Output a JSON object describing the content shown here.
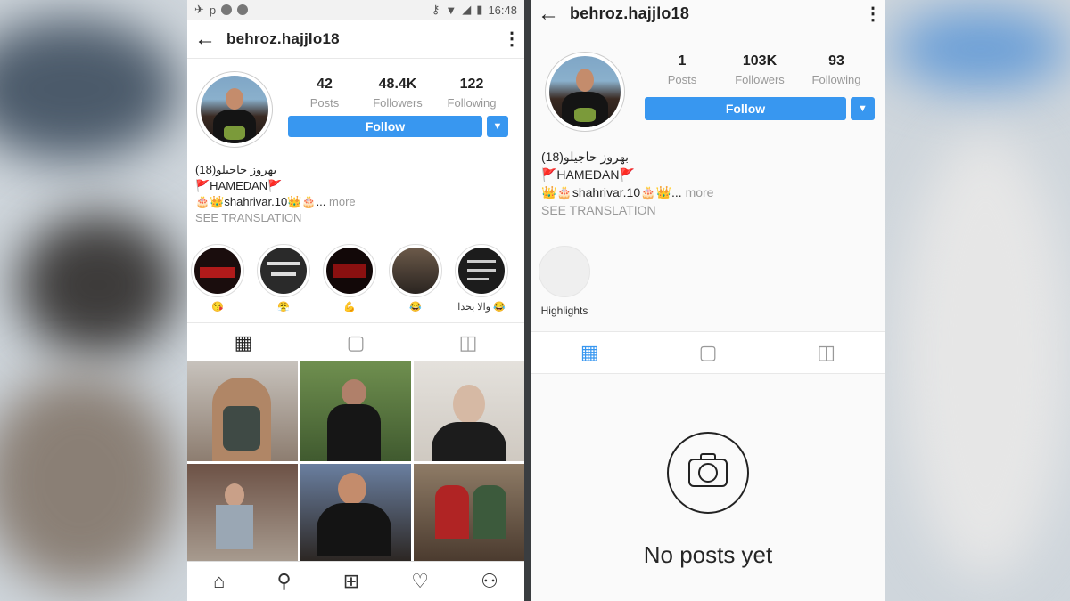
{
  "left": {
    "status": {
      "time": "16:48"
    },
    "username": "behroz.hajjlo18",
    "stats": [
      {
        "value": "42",
        "label": "Posts"
      },
      {
        "value": "48.4K",
        "label": "Followers"
      },
      {
        "value": "122",
        "label": "Following"
      }
    ],
    "follow_label": "Follow",
    "bio": {
      "line1": "بهروز حاجیلو(18)",
      "line2": "🚩HAMEDAN🚩",
      "line3": "🎂👑shahrivar.10👑🎂...",
      "more": "more",
      "translate": "SEE TRANSLATION"
    },
    "highlights": [
      {
        "label": "😘"
      },
      {
        "label": "😤"
      },
      {
        "label": "💪"
      },
      {
        "label": "😂"
      },
      {
        "label": "والا بخدا 😂"
      }
    ]
  },
  "right": {
    "username": "behroz.hajjlo18",
    "stats": [
      {
        "value": "1",
        "label": "Posts"
      },
      {
        "value": "103K",
        "label": "Followers"
      },
      {
        "value": "93",
        "label": "Following"
      }
    ],
    "follow_label": "Follow",
    "bio": {
      "line1": "بهروز حاجیلو(18)",
      "line2": "🚩HAMEDAN🚩",
      "line3": "👑🎂shahrivar.10🎂👑...",
      "more": "more",
      "translate": "SEE TRANSLATION"
    },
    "highlights_label": "Highlights",
    "empty_text": "No posts yet"
  },
  "colors": {
    "accent": "#3897f0"
  }
}
